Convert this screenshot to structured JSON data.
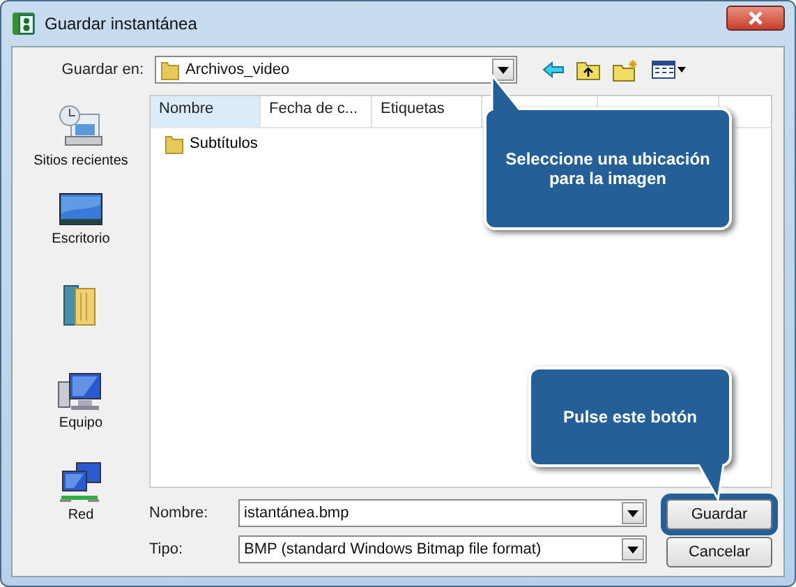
{
  "window": {
    "title": "Guardar instantánea"
  },
  "save_in": {
    "label": "Guardar en:",
    "value": "Archivos_video"
  },
  "places": [
    {
      "label": "Sitios recientes",
      "kind": "recent"
    },
    {
      "label": "Escritorio",
      "kind": "desktop"
    },
    {
      "kind": "user"
    },
    {
      "label": "Equipo",
      "kind": "computer"
    },
    {
      "label": "Red",
      "kind": "network"
    }
  ],
  "columns": [
    {
      "label": "Nombre",
      "selected": true
    },
    {
      "label": "Fecha de c...",
      "selected": false
    },
    {
      "label": "Etiquetas",
      "selected": false
    }
  ],
  "files": [
    {
      "name": "Subtítulos"
    }
  ],
  "file_name": {
    "label": "Nombre:",
    "value": "istantánea.bmp"
  },
  "file_type": {
    "label": "Tipo:",
    "value": "BMP (standard Windows Bitmap file format)"
  },
  "buttons": [
    {
      "label": "Guardar",
      "highlighted": true
    },
    {
      "label": "Cancelar",
      "highlighted": false
    }
  ],
  "callouts": [
    {
      "text": "Seleccione una ubicación para la imagen",
      "kind": "tail_up"
    },
    {
      "text": "Pulse este botón",
      "kind": "tail_down"
    }
  ]
}
